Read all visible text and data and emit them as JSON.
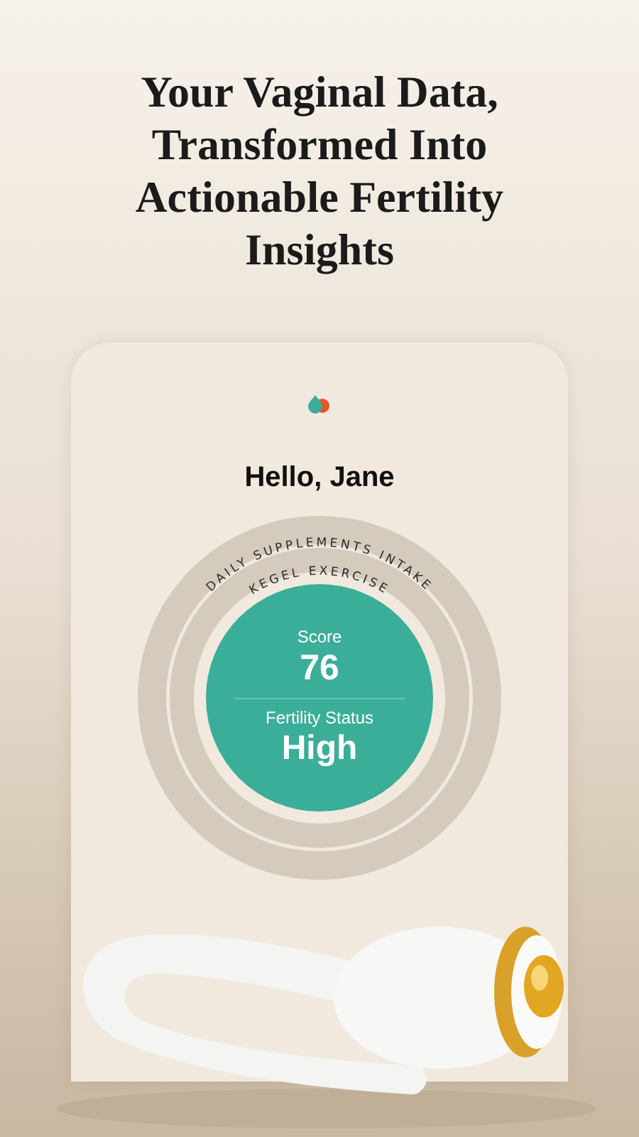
{
  "headline": "Your Vaginal Data, Transformed Into Actionable Fertility Insights",
  "app": {
    "greeting": "Hello, Jane",
    "rings": [
      {
        "label": "DAILY SUPPLEMENTS INTAKE"
      },
      {
        "label": "KEGEL EXERCISE"
      }
    ],
    "score": {
      "label": "Score",
      "value": "76"
    },
    "status": {
      "label": "Fertility Status",
      "value": "High"
    }
  }
}
